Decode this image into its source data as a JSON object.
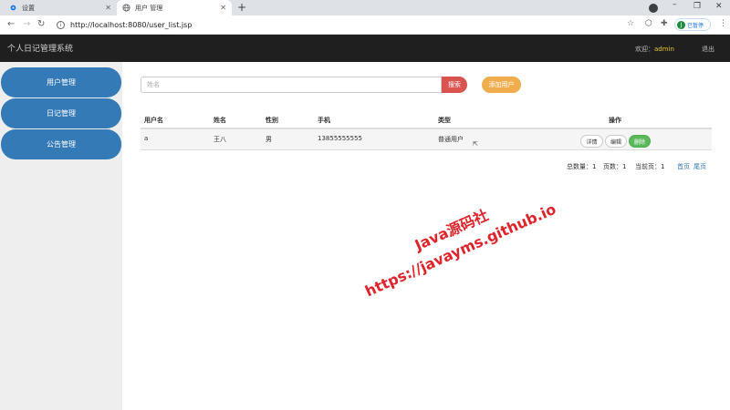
{
  "browser": {
    "tabs": [
      {
        "title": "设置",
        "icon": "gear-icon"
      },
      {
        "title": "用户 管理",
        "icon": "globe-icon"
      }
    ],
    "new_tab": "+",
    "url": "http://localhost:8080/user_list.jsp",
    "profile_initial": "J",
    "profile_label": "已暂停"
  },
  "header": {
    "app_title": "个人日记管理系统",
    "welcome_label": "欢迎：",
    "username": "admin",
    "logout": "退出"
  },
  "sidebar": {
    "items": [
      {
        "label": "用户管理"
      },
      {
        "label": "日记管理"
      },
      {
        "label": "公告管理"
      }
    ]
  },
  "toolbar": {
    "search_placeholder": "姓名",
    "search_button": "搜索",
    "add_button": "添加用户"
  },
  "table": {
    "columns": [
      "用户名",
      "姓名",
      "性别",
      "手机",
      "类型",
      "操作"
    ],
    "rows": [
      {
        "username": "a",
        "name": "王八",
        "gender": "男",
        "phone": "13855555555",
        "type": "普通用户"
      }
    ],
    "actions": {
      "detail": "详情",
      "edit": "编辑",
      "delete": "删除"
    }
  },
  "pagination": {
    "total_label": "总数量：",
    "total": "1",
    "pages_label": "页数：",
    "pages": "1",
    "current_label": "当前页：",
    "current": "1",
    "first": "首页",
    "last": "尾页"
  },
  "watermark": {
    "line1": "Java源码社",
    "line2": "https://javayms.github.io"
  }
}
